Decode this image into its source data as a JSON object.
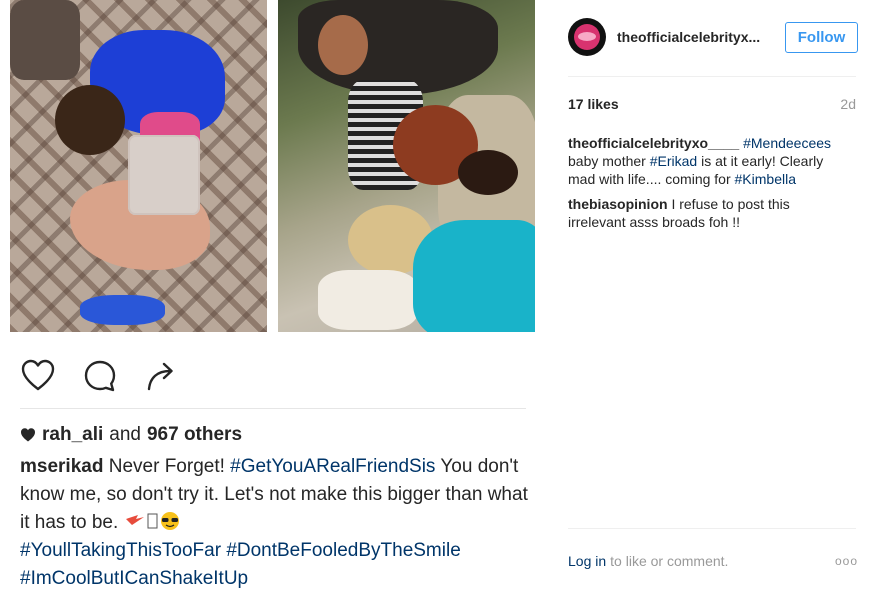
{
  "post": {
    "likes_user": "rah_ali",
    "likes_and": "and",
    "likes_others": "967 others",
    "caption_user": "mserikad",
    "caption_text_1": "Never Forget!",
    "caption_tag_1": "#GetYouARealFriendSis",
    "caption_text_2": "You don't know me, so don't try it. Let's not make this bigger than what it has to be.",
    "caption_tag_2": "#YoullTakingThisTooFar",
    "caption_tag_3": "#DontBeFooledByTheSmile",
    "caption_tag_4": "#ImCoolButICanShakeItUp",
    "icons": {
      "like": "heart-outline-icon",
      "comment": "speech-bubble-icon",
      "share": "share-arrow-icon"
    }
  },
  "sidebar": {
    "handle": "theofficialcelebrityx...",
    "follow_label": "Follow",
    "likes": "17 likes",
    "time": "2d",
    "comments": [
      {
        "user": "theofficialcelebrityxo____",
        "tag_a": "#Mendeecees",
        "text_a": "baby mother",
        "tag_b": "#Erikad",
        "text_b": "is at it early! Clearly mad with life.... coming for",
        "tag_c": "#Kimbella"
      },
      {
        "user": "thebiasopinion",
        "text": "I refuse to post this irrelevant asss broads foh !!"
      }
    ],
    "footer_login": "Log in",
    "footer_rest": "to like or comment.",
    "more": "ooo"
  },
  "colors": {
    "link": "#003569",
    "follow_blue": "#3897f0",
    "muted": "#999999"
  }
}
